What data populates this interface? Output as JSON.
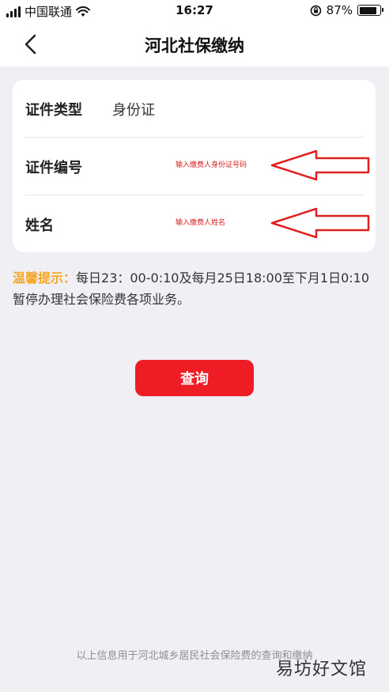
{
  "status_bar": {
    "carrier": "中国联通",
    "time": "16:27",
    "battery_percent": "87%",
    "battery_level": 0.87
  },
  "nav": {
    "title": "河北社保缴纳",
    "back_icon": "chevron-left-icon"
  },
  "form": {
    "id_type": {
      "label": "证件类型",
      "value": "身份证"
    },
    "id_number": {
      "label": "证件编号",
      "placeholder": "输入缴费人身份证号码"
    },
    "name": {
      "label": "姓名",
      "placeholder": "输入缴费人姓名"
    }
  },
  "annotations": {
    "arrow_color": "#e02020"
  },
  "tip": {
    "label": "温馨提示：",
    "text": "每日23：00-0:10及每月25日18:00至下月1日0:10暂停办理社会保险费各项业务。"
  },
  "query_button": {
    "label": "查询",
    "color": "#ee1c25"
  },
  "footer": {
    "note": "以上信息用于河北城乡居民社会保险费的查询和缴纳"
  },
  "watermark": {
    "text": "易坊好文馆"
  }
}
